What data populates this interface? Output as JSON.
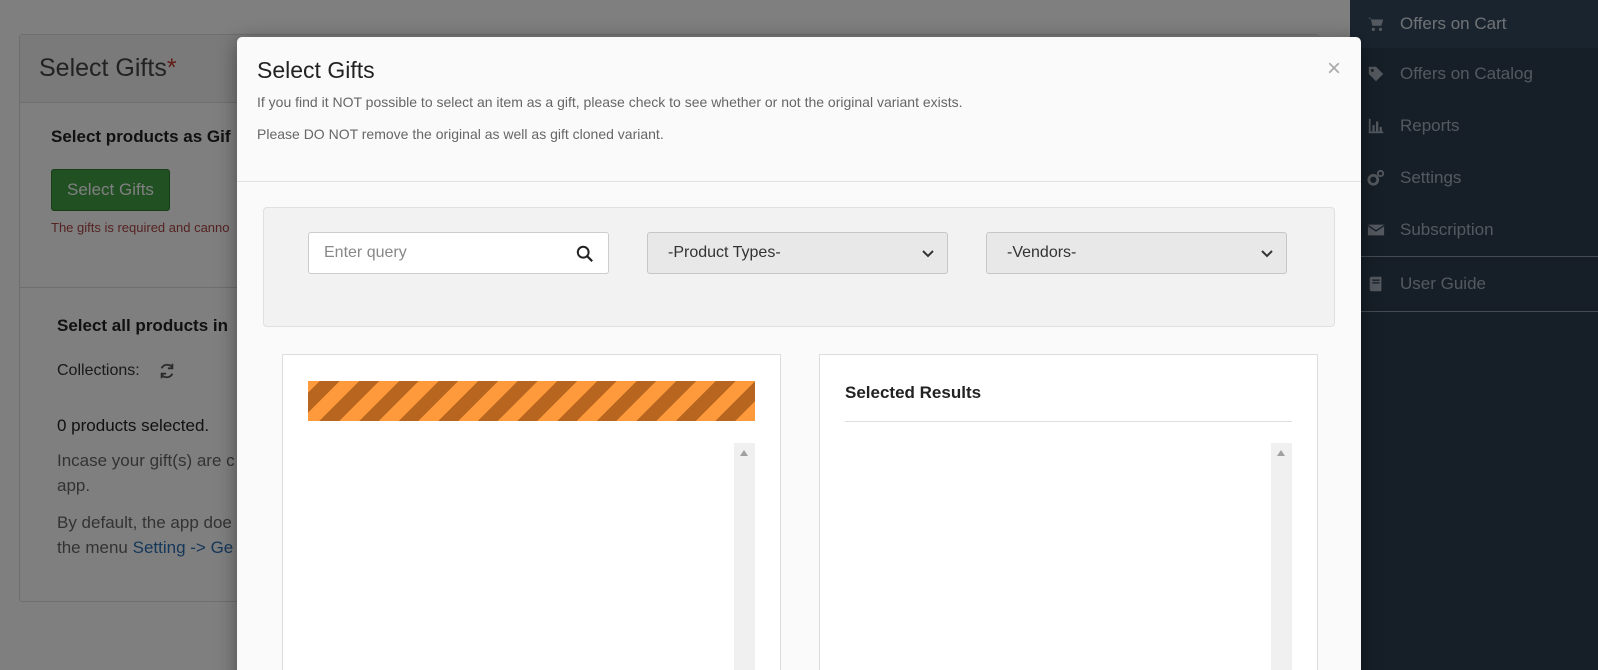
{
  "background": {
    "panel_title": "Select Gifts",
    "required_mark": "*",
    "select_products_label": "Select products as Gif",
    "select_gifts_button": "Select Gifts",
    "error_text": "The gifts is required and canno",
    "select_all_label": "Select all products in",
    "collections_label": "Collections:",
    "products_selected": "0 products selected.",
    "para1_line1": "Incase your gift(s) are c",
    "para1_line2": "app.",
    "para2_line1": "By default, the app doe",
    "para2_line2_prefix": "the menu ",
    "para2_link": "Setting -> Ge"
  },
  "sidebar": {
    "items": [
      {
        "label": "Offers on Cart",
        "icon": "cart-icon",
        "active": true
      },
      {
        "label": "Offers on Catalog",
        "icon": "tag-icon"
      },
      {
        "label": "Reports",
        "icon": "bar-chart-icon"
      },
      {
        "label": "Settings",
        "icon": "gears-icon"
      },
      {
        "label": "Subscription",
        "icon": "envelope-icon"
      },
      {
        "label": "User Guide",
        "icon": "book-icon"
      }
    ]
  },
  "modal": {
    "title": "Select Gifts",
    "close_label": "×",
    "note1": "If you find it NOT possible to select an item as a gift, please check to see whether or not the original variant exists.",
    "note2": "Please DO NOT remove the original as well as gift cloned variant.",
    "search": {
      "placeholder": "Enter query",
      "value": ""
    },
    "product_types": {
      "selected": "-Product Types-"
    },
    "vendors": {
      "selected": "-Vendors-"
    },
    "selected_results_title": "Selected Results"
  },
  "colors": {
    "sidebar_bg": "#2c3e50",
    "green_button": "#43a047",
    "loading_stripe_light": "#ff9a3c",
    "loading_stripe_dark": "#b8661f"
  }
}
